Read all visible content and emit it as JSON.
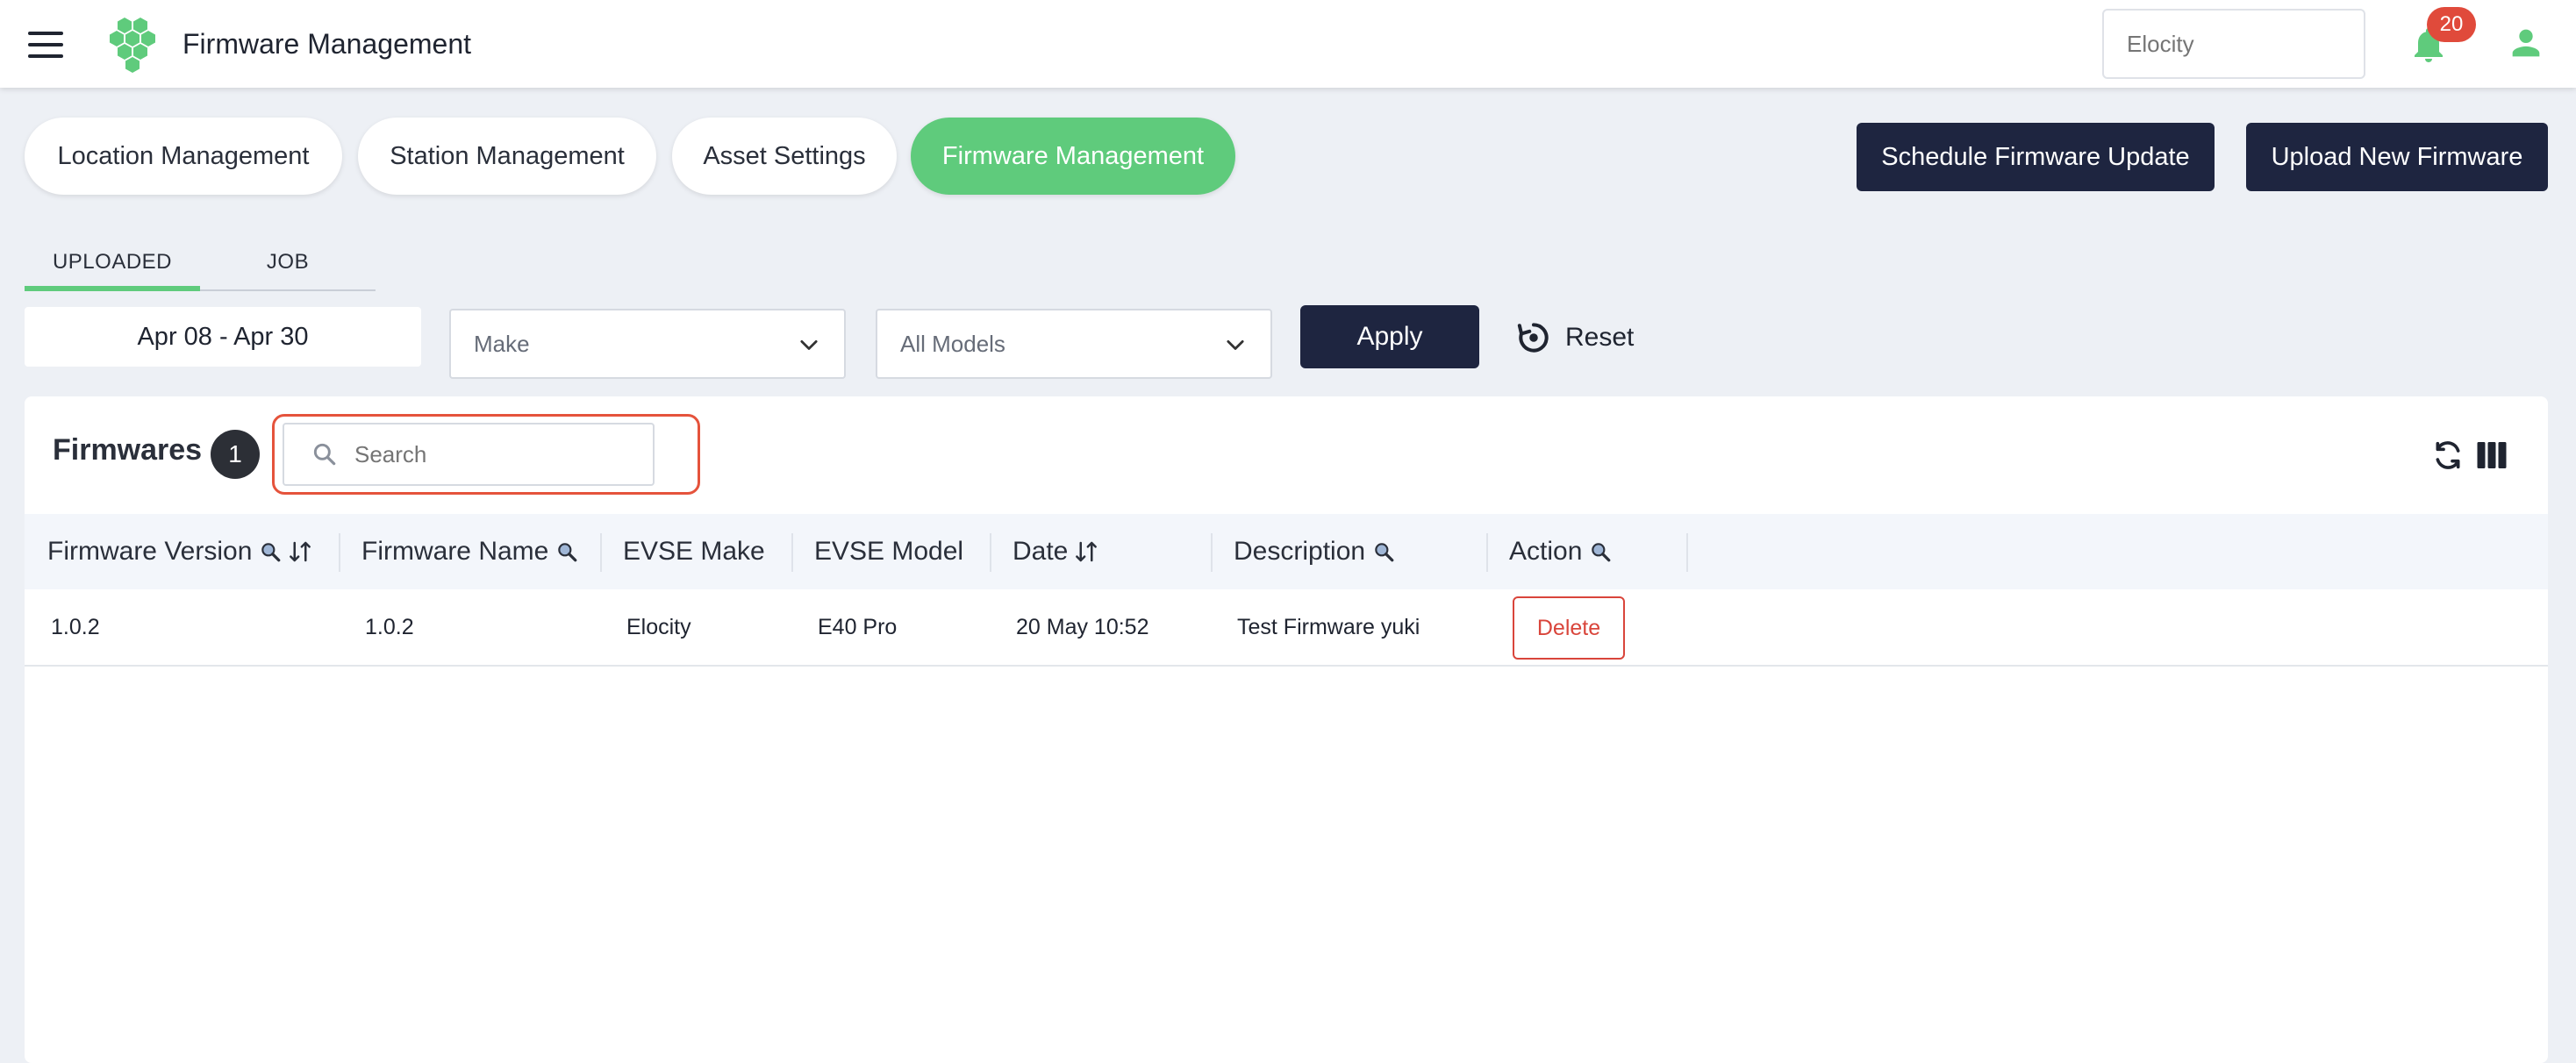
{
  "header": {
    "title": "Firmware Management",
    "org_placeholder": "Elocity",
    "notification_count": "20",
    "brand_color": "#5fcb7c"
  },
  "tabs": [
    {
      "label": "Location Management",
      "active": false
    },
    {
      "label": "Station Management",
      "active": false
    },
    {
      "label": "Asset Settings",
      "active": false
    },
    {
      "label": "Firmware Management",
      "active": true
    }
  ],
  "actions": {
    "schedule_label": "Schedule Firmware Update",
    "upload_label": "Upload New Firmware"
  },
  "subtabs": [
    {
      "label": "UPLOADED",
      "active": true
    },
    {
      "label": "JOB",
      "active": false
    }
  ],
  "filters": {
    "date_range": "Apr 08 - Apr 30",
    "make_placeholder": "Make",
    "model_placeholder": "All Models",
    "apply_label": "Apply",
    "reset_label": "Reset"
  },
  "table": {
    "title": "Firmwares",
    "count": "1",
    "search_placeholder": "Search",
    "columns": [
      "Firmware Version",
      "Firmware Name",
      "EVSE Make",
      "EVSE Model",
      "Date",
      "Description",
      "Action"
    ],
    "rows": [
      {
        "firmware_version": "1.0.2",
        "firmware_name": "1.0.2",
        "evse_make": "Elocity",
        "evse_model": "E40 Pro",
        "date": "20 May 10:52",
        "description": "Test Firmware yuki",
        "action_label": "Delete"
      }
    ]
  }
}
